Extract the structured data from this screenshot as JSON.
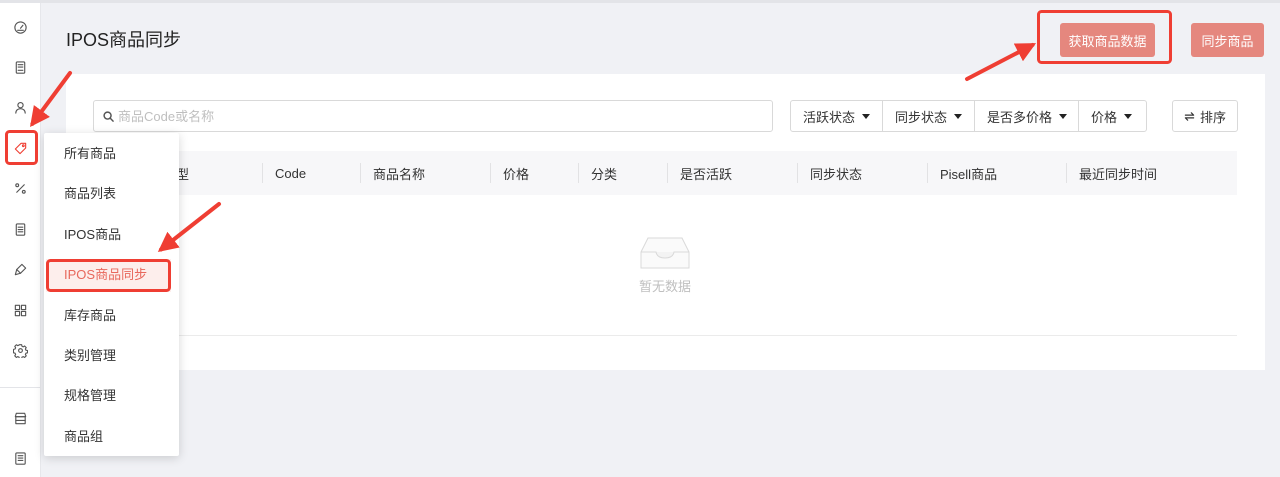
{
  "page": {
    "title": "IPOS商品同步"
  },
  "header_actions": {
    "fetch_label": "获取商品数据",
    "sync_label": "同步商品"
  },
  "sidebar": {
    "items": [
      {
        "icon": "dashboard-icon"
      },
      {
        "icon": "orders-icon"
      },
      {
        "icon": "user-icon"
      },
      {
        "icon": "tag-icon",
        "active": true
      },
      {
        "icon": "percent-icon"
      },
      {
        "icon": "report-icon"
      },
      {
        "icon": "tools-icon"
      },
      {
        "icon": "apps-grid-icon"
      },
      {
        "icon": "settings-gear-icon"
      }
    ],
    "bottom_items": [
      {
        "icon": "store-icon"
      },
      {
        "icon": "notes-icon"
      }
    ]
  },
  "product_menu": {
    "items": [
      {
        "label": "所有商品"
      },
      {
        "label": "商品列表"
      },
      {
        "label": "IPOS商品"
      },
      {
        "label": "IPOS商品同步",
        "active": true
      },
      {
        "label": "库存商品"
      },
      {
        "label": "类别管理"
      },
      {
        "label": "规格管理"
      },
      {
        "label": "商品组"
      }
    ]
  },
  "search": {
    "placeholder": "商品Code或名称",
    "value": "",
    "icon": "search-icon"
  },
  "filters": [
    {
      "label": "活跃状态",
      "icon": "caret-down-icon"
    },
    {
      "label": "同步状态",
      "icon": "caret-down-icon"
    },
    {
      "label": "是否多价格",
      "icon": "caret-down-icon"
    },
    {
      "label": "价格",
      "icon": "caret-down-icon"
    }
  ],
  "sort": {
    "label": "排序",
    "icon": "swap-icon"
  },
  "table": {
    "columns": [
      "型",
      "Code",
      "商品名称",
      "价格",
      "分类",
      "是否活跃",
      "同步状态",
      "Pisell商品",
      "最近同步时间"
    ],
    "rows": []
  },
  "empty_state": {
    "text": "暂无数据",
    "icon": "empty-inbox-icon"
  },
  "colors": {
    "accent": "#e5877e",
    "annotation": "#ef3e33",
    "active_menu_bg": "#fdeeec",
    "active_menu_text": "#e8685d",
    "page_bg": "#f0f1f5"
  }
}
